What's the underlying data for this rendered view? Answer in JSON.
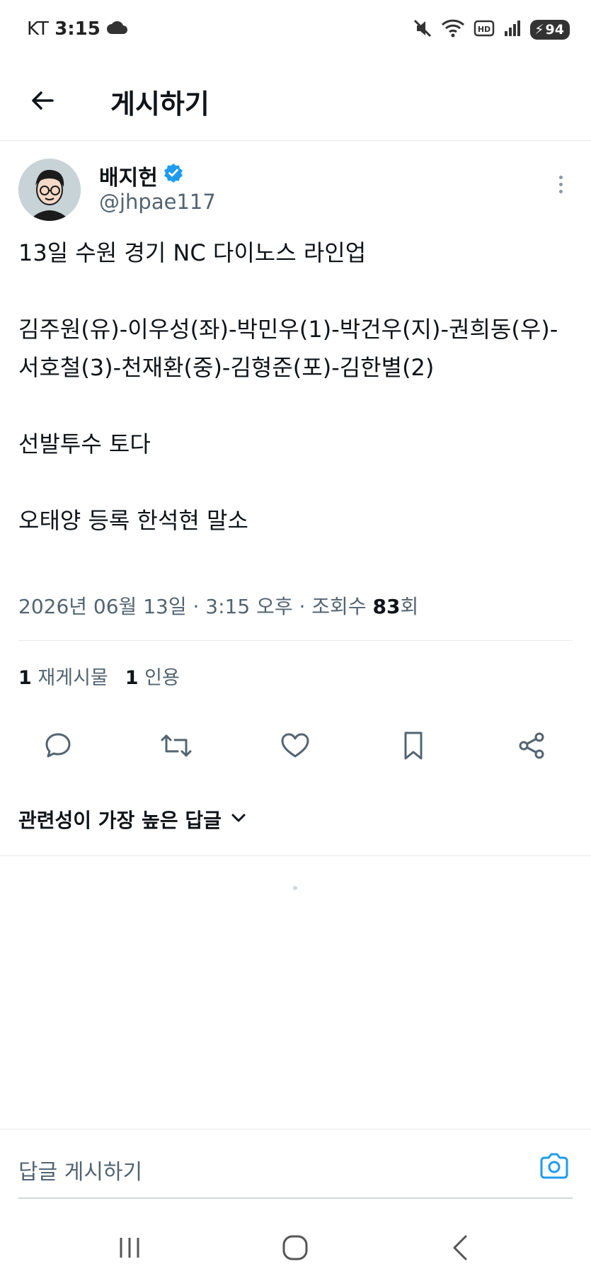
{
  "status_bar": {
    "carrier": "KT",
    "time": "3:15",
    "battery": "94",
    "icons": [
      "cloud-icon",
      "mute-icon",
      "wifi-icon",
      "hd-icon",
      "signal-icon",
      "battery-icon"
    ]
  },
  "header": {
    "title": "게시하기",
    "back_icon": "arrow-left-icon"
  },
  "tweet": {
    "author_name": "배지헌",
    "verified": true,
    "author_handle": "@jhpae117",
    "lines": [
      "13일 수원 경기 NC 다이노스 라인업",
      "김주원(유)-이우성(좌)-박민우(1)-박건우(지)-권희동(우)-서호철(3)-천재환(중)-김형준(포)-김한별(2)",
      "선발투수 토다",
      "오태양 등록 한석현 말소"
    ],
    "meta_prefix": "2026년 06월 13일 · 3:15 오후 · 조회수 ",
    "views": "83",
    "views_suffix": "회",
    "reposts_count": "1",
    "reposts_label": "재게시물",
    "quotes_count": "1",
    "quotes_label": "인용"
  },
  "actions": [
    "reply-icon",
    "repost-icon",
    "like-icon",
    "bookmark-icon",
    "share-icon"
  ],
  "replies": {
    "sort_label": "관련성이 가장 높은 답글"
  },
  "composer": {
    "placeholder": "답글 게시하기"
  },
  "colors": {
    "accent": "#1d9bf0",
    "text": "#0f1419",
    "secondary": "#536471",
    "divider": "#e6e9eb"
  }
}
